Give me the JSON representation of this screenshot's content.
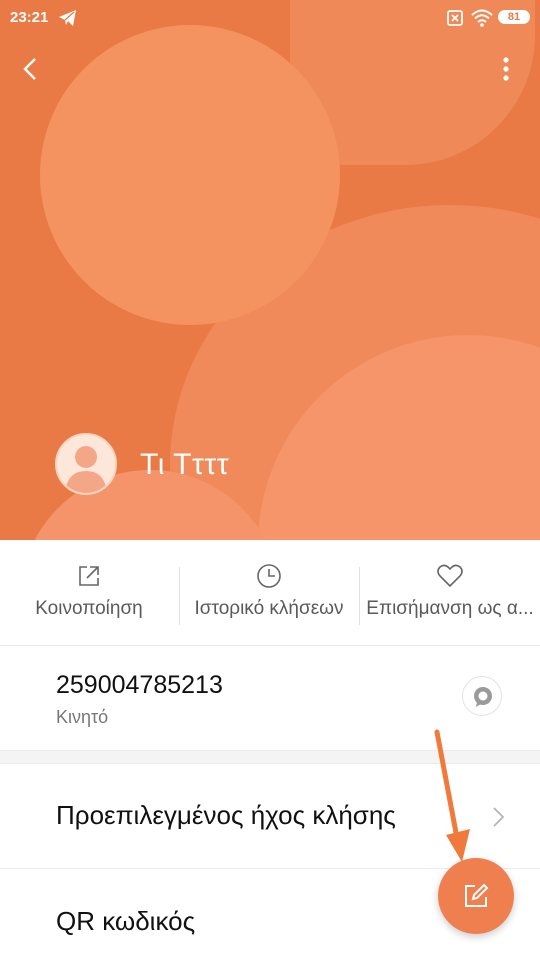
{
  "status_bar": {
    "time": "23:21",
    "battery": "81",
    "icons": [
      "telegram-icon",
      "no-sim-icon",
      "wifi-icon",
      "battery-icon"
    ]
  },
  "header": {
    "contact_name": "Τι Ττττ",
    "accent_color": "#ea7a45"
  },
  "actions": [
    {
      "label": "Κοινοποίηση",
      "icon": "share-icon"
    },
    {
      "label": "Ιστορικό κλήσεων",
      "icon": "clock-icon"
    },
    {
      "label": "Επισήμανση ως α...",
      "icon": "heart-icon"
    }
  ],
  "phone": {
    "number": "259004785213",
    "type": "Κινητό"
  },
  "settings": {
    "ringtone_label": "Προεπιλεγμένος ήχος κλήσης",
    "qr_label": "QR κωδικός"
  },
  "colors": {
    "fab": "#f07f4f",
    "annotation_arrow": "#f07a3c"
  }
}
